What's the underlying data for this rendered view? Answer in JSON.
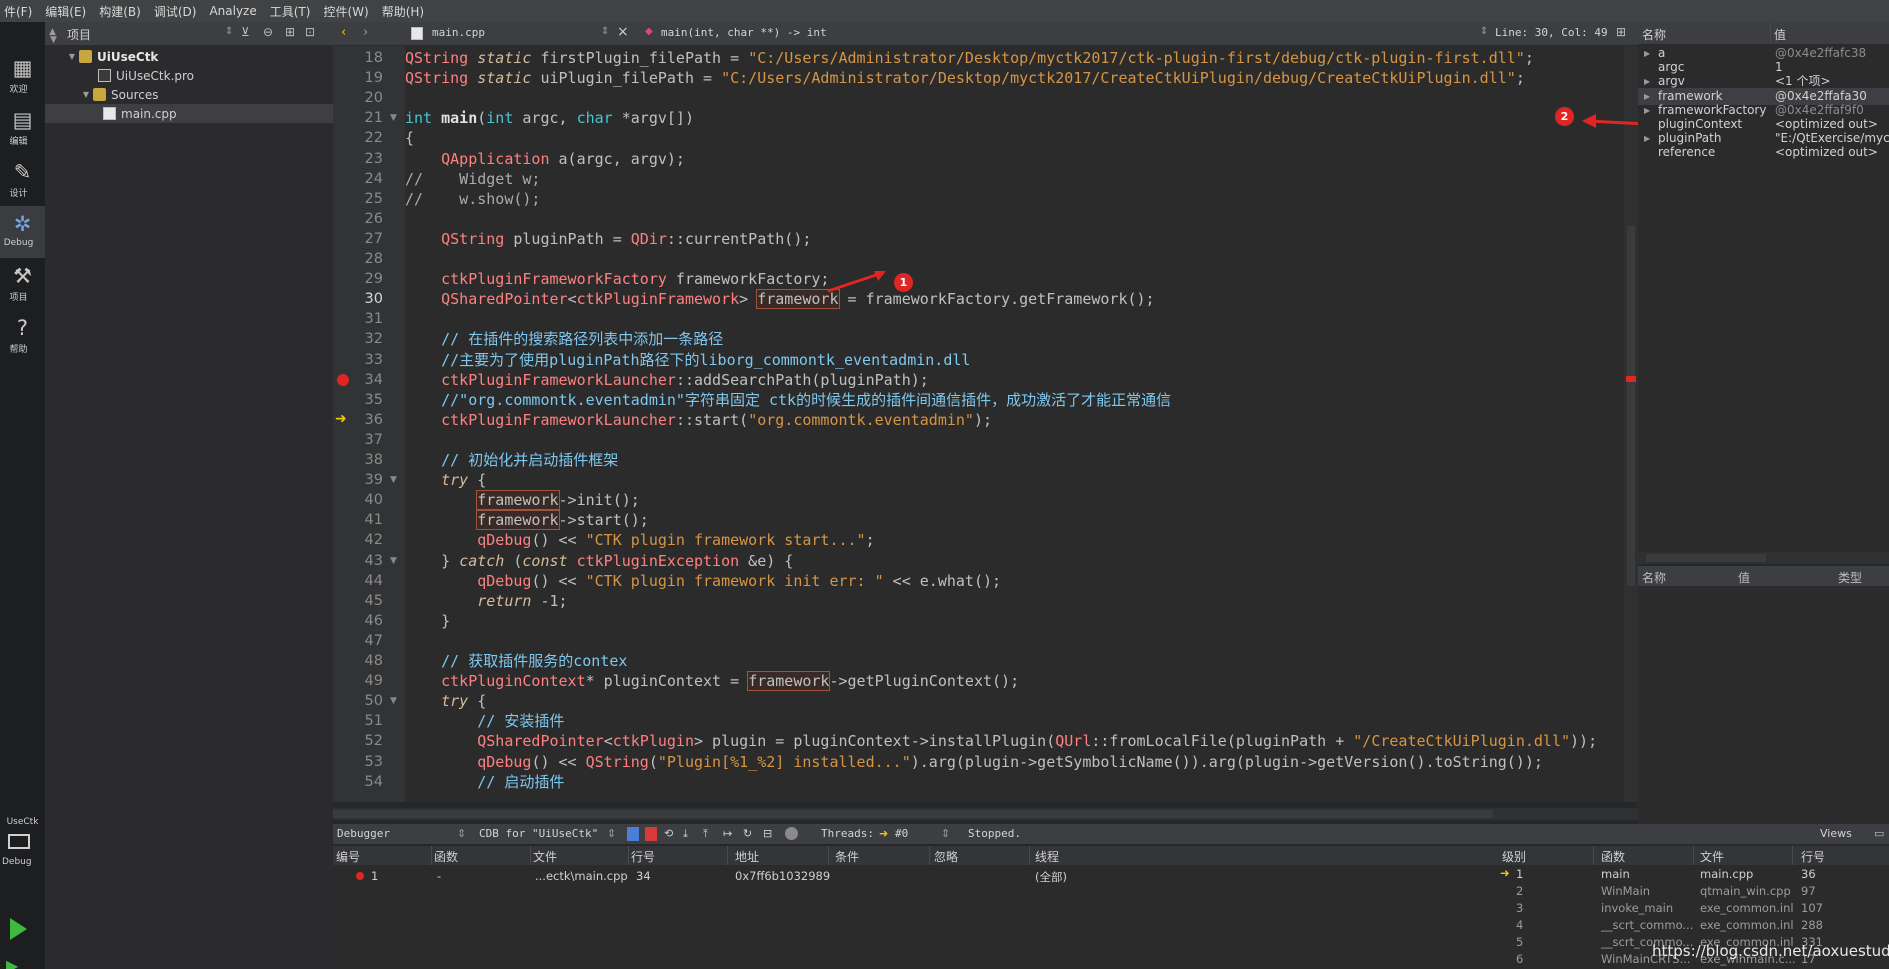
{
  "menu": [
    "件(F)",
    "编辑(E)",
    "构建(B)",
    "调试(D)",
    "Analyze",
    "工具(T)",
    "控件(W)",
    "帮助(H)"
  ],
  "modes": [
    {
      "label": "欢迎",
      "icon": "grid-icon"
    },
    {
      "label": "编辑",
      "icon": "edit-icon"
    },
    {
      "label": "设计",
      "icon": "pen-icon"
    },
    {
      "label": "Debug",
      "icon": "bug-icon"
    },
    {
      "label": "项目",
      "icon": "wrench-icon"
    },
    {
      "label": "帮助",
      "icon": "help-icon"
    }
  ],
  "kit": {
    "project": "UseCtk",
    "build": "Debug"
  },
  "project_pane": {
    "title": "项目",
    "tree": [
      {
        "label": "UiUseCtk",
        "level": 0
      },
      {
        "label": "UiUseCtk.pro",
        "level": 1
      },
      {
        "label": "Sources",
        "level": 1
      },
      {
        "label": "main.cpp",
        "level": 2
      }
    ]
  },
  "editor": {
    "file_tab": "main.cpp",
    "function_combo": "main(int, char **) -> int",
    "cursor_pos": "Line: 30, Col: 49",
    "current_line": 30,
    "breakpoint_line": 34,
    "exec_line": 36,
    "line_numbers": [
      18,
      19,
      20,
      21,
      22,
      23,
      24,
      25,
      26,
      27,
      28,
      29,
      30,
      31,
      32,
      33,
      34,
      35,
      36,
      37,
      38,
      39,
      40,
      41,
      42,
      43,
      44,
      45,
      46,
      47,
      48,
      49,
      50,
      51,
      52,
      53,
      54
    ],
    "lines": [
      "QString static firstPlugin_filePath = \"C:/Users/Administrator/Desktop/myctk2017/ctk-plugin-first/debug/ctk-plugin-first.dll\";",
      "QString static uiPlugin_filePath = \"C:/Users/Administrator/Desktop/myctk2017/CreateCtkUiPlugin/debug/CreateCtkUiPlugin.dll\";",
      "",
      "int main(int argc, char *argv[])",
      "{",
      "    QApplication a(argc, argv);",
      "//    Widget w;",
      "//    w.show();",
      "",
      "    QString pluginPath = QDir::currentPath();",
      "",
      "    ctkPluginFrameworkFactory frameworkFactory;",
      "    QSharedPointer<ctkPluginFramework> framework = frameworkFactory.getFramework();",
      "",
      "    // 在插件的搜索路径列表中添加一条路径",
      "    //主要为了使用pluginPath路径下的liborg_commontk_eventadmin.dll",
      "    ctkPluginFrameworkLauncher::addSearchPath(pluginPath);",
      "    //\"org.commontk.eventadmin\"字符串固定 ctk的时候生成的插件间通信插件，成功激活了才能正常通信",
      "    ctkPluginFrameworkLauncher::start(\"org.commontk.eventadmin\");",
      "",
      "    // 初始化并启动插件框架",
      "    try {",
      "        framework->init();",
      "        framework->start();",
      "        qDebug() << \"CTK plugin framework start...\";",
      "    } catch (const ctkPluginException &e) {",
      "        qDebug() << \"CTK plugin framework init err: \" << e.what();",
      "        return -1;",
      "    }",
      "",
      "    // 获取插件服务的contex",
      "    ctkPluginContext* pluginContext = framework->getPluginContext();",
      "    try {",
      "        // 安装插件",
      "        QSharedPointer<ctkPlugin> plugin = pluginContext->installPlugin(QUrl::fromLocalFile(pluginPath + \"/CreateCtkUiPlugin.dll\"));",
      "        qDebug() << QString(\"Plugin[%1_%2] installed...\").arg(plugin->getSymbolicName()).arg(plugin->getVersion().toString());",
      "        // 启动插件"
    ]
  },
  "annotations": [
    "1",
    "2"
  ],
  "locals": {
    "header_name": "名称",
    "header_value": "值",
    "rows": [
      {
        "name": "a",
        "value": "@0x4e2ffafc38",
        "expand": true,
        "dim": true
      },
      {
        "name": "argc",
        "value": "1",
        "expand": false,
        "dim": false
      },
      {
        "name": "argv",
        "value": "<1 个项>",
        "expand": true,
        "dim": false
      },
      {
        "name": "framework",
        "value": "@0x4e2ffafa30",
        "expand": true,
        "dim": false
      },
      {
        "name": "frameworkFactory",
        "value": "@0x4e2ffaf9f0",
        "expand": true,
        "dim": true
      },
      {
        "name": "pluginContext",
        "value": "<optimized out>",
        "expand": false,
        "dim": false
      },
      {
        "name": "pluginPath",
        "value": "\"E:/QtExercise/myct",
        "expand": true,
        "dim": false
      },
      {
        "name": "reference",
        "value": "<optimized out>",
        "expand": false,
        "dim": false
      }
    ]
  },
  "watch": {
    "headers": [
      "名称",
      "值",
      "类型"
    ]
  },
  "debugger_bar": {
    "view": "Debugger",
    "engine": "CDB for \"UiUseCtk\"",
    "threads_label": "Threads:",
    "thread": "#0",
    "status": "Stopped.",
    "views": "Views"
  },
  "breakpoints": {
    "headers": [
      "编号",
      "函数",
      "文件",
      "行号",
      "地址",
      "条件",
      "忽略",
      "线程"
    ],
    "rows": [
      {
        "num": "1",
        "func": "-",
        "file": "...ectk\\main.cpp",
        "line": "34",
        "addr": "0x7ff6b1032989",
        "cond": "",
        "ignore": "",
        "thread": "(全部)"
      }
    ]
  },
  "stack": {
    "headers": [
      "级别",
      "函数",
      "文件",
      "行号"
    ],
    "rows": [
      {
        "level": "1",
        "func": "main",
        "file": "main.cpp",
        "line": "36",
        "current": true
      },
      {
        "level": "2",
        "func": "WinMain",
        "file": "qtmain_win.cpp",
        "line": "97",
        "current": false
      },
      {
        "level": "3",
        "func": "invoke_main",
        "file": "exe_common.inl",
        "line": "107",
        "current": false
      },
      {
        "level": "4",
        "func": "__scrt_commo...",
        "file": "exe_common.inl",
        "line": "288",
        "current": false
      },
      {
        "level": "5",
        "func": "__scrt_commo...",
        "file": "exe_common.inl",
        "line": "331",
        "current": false
      },
      {
        "level": "6",
        "func": "WinMainCRTS...",
        "file": "exe_winmain.c...",
        "line": "17",
        "current": false
      }
    ]
  },
  "watermark": "https://blog.csdn.net/aoxuestudy",
  "colors": {
    "breakpoint": "#e02525",
    "exec_arrow": "#f0c800",
    "annotation": "#e02525"
  }
}
